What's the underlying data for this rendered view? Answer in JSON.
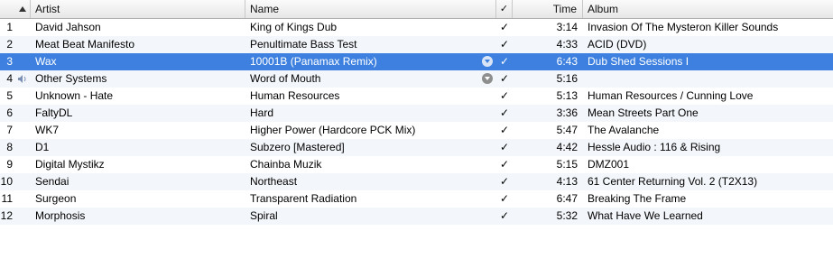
{
  "columns": {
    "index": "",
    "artist": "Artist",
    "name": "Name",
    "check": "✓",
    "time": "Time",
    "album": "Album"
  },
  "tracks": [
    {
      "index": "1",
      "artist": "David Jahson",
      "name": "King of Kings Dub",
      "checked": "✓",
      "time": "3:14",
      "album": "Invasion Of The Mysteron Killer Sounds"
    },
    {
      "index": "2",
      "artist": "Meat Beat Manifesto",
      "name": "Penultimate Bass Test",
      "checked": "✓",
      "time": "4:33",
      "album": "ACID (DVD)"
    },
    {
      "index": "3",
      "artist": "Wax",
      "name": "10001B (Panamax Remix)",
      "checked": "✓",
      "time": "6:43",
      "album": "Dub Shed Sessions I"
    },
    {
      "index": "4",
      "artist": "Other Systems",
      "name": "Word of Mouth",
      "checked": "✓",
      "time": "5:16",
      "album": ""
    },
    {
      "index": "5",
      "artist": "Unknown - Hate",
      "name": "Human Resources",
      "checked": "✓",
      "time": "5:13",
      "album": "Human Resources / Cunning Love"
    },
    {
      "index": "6",
      "artist": "FaltyDL",
      "name": "Hard",
      "checked": "✓",
      "time": "3:36",
      "album": "Mean Streets Part One"
    },
    {
      "index": "7",
      "artist": "WK7",
      "name": "Higher Power (Hardcore PCK Mix)",
      "checked": "✓",
      "time": "5:47",
      "album": "The Avalanche"
    },
    {
      "index": "8",
      "artist": "D1",
      "name": "Subzero [Mastered]",
      "checked": "✓",
      "time": "4:42",
      "album": "Hessle Audio : 116 & Rising"
    },
    {
      "index": "9",
      "artist": "Digital Mystikz",
      "name": "Chainba Muzik",
      "checked": "✓",
      "time": "5:15",
      "album": "DMZ001"
    },
    {
      "index": "10",
      "artist": "Sendai",
      "name": "Northeast",
      "checked": "✓",
      "time": "4:13",
      "album": "61 Center Returning Vol. 2 (T2X13)"
    },
    {
      "index": "11",
      "artist": "Surgeon",
      "name": "Transparent Radiation",
      "checked": "✓",
      "time": "6:47",
      "album": "Breaking The Frame"
    },
    {
      "index": "12",
      "artist": "Morphosis",
      "name": "Spiral",
      "checked": "✓",
      "time": "5:32",
      "album": "What Have We Learned"
    }
  ],
  "state": {
    "selected_row": "3",
    "playing_row": "4",
    "sort_column": "index",
    "sort_direction": "ascending",
    "selection_color": "#3d80df"
  }
}
